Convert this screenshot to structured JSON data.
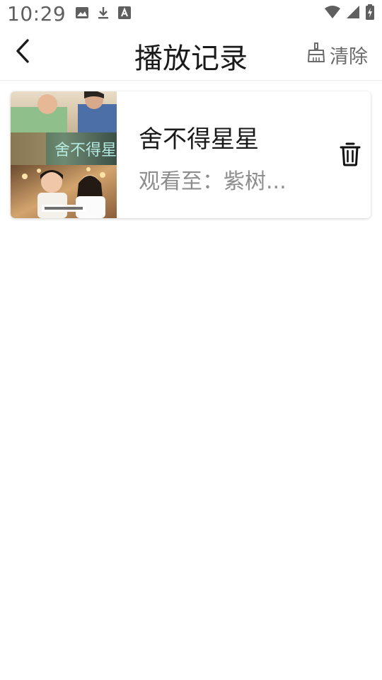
{
  "status_bar": {
    "time": "10:29",
    "left_icons": [
      "image-icon",
      "download-icon",
      "font-icon"
    ],
    "right_icons": [
      "wifi-icon",
      "signal-icon",
      "battery-charging-icon"
    ]
  },
  "header": {
    "back_icon": "chevron-left-icon",
    "title": "播放记录",
    "clear_icon": "broom-icon",
    "clear_label": "清除"
  },
  "records": [
    {
      "title": "舍不得星星",
      "progress": "观看至：紫树...",
      "poster_text": "舍不得星星",
      "delete_icon": "trash-icon"
    }
  ]
}
